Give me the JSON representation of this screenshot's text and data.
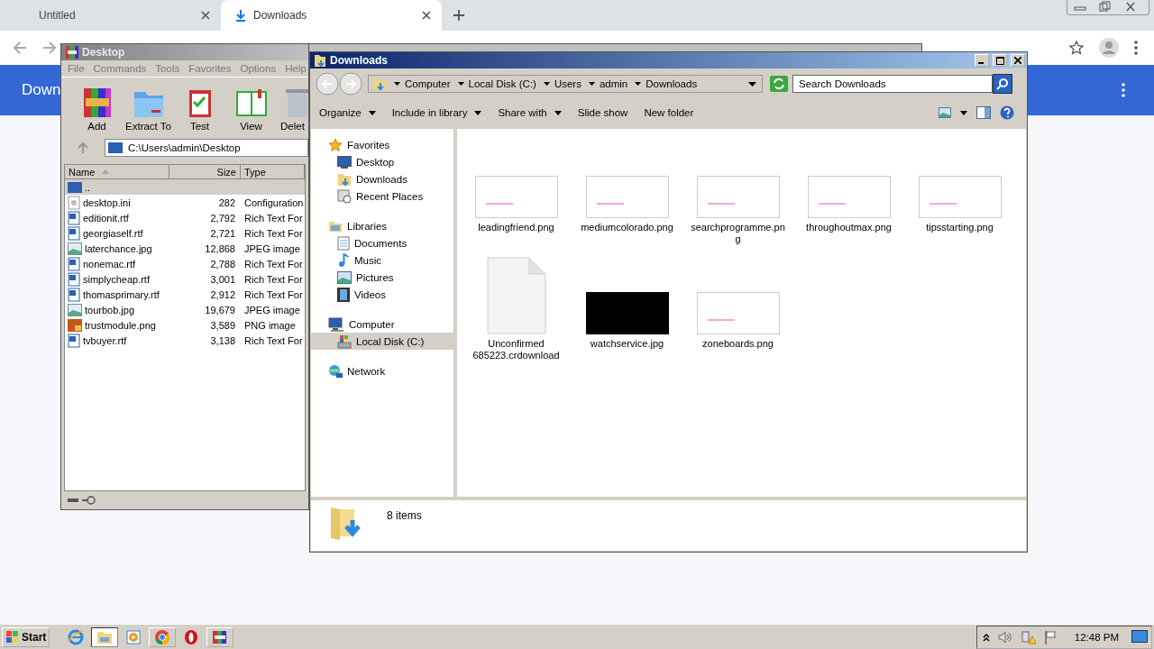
{
  "browser": {
    "tabs": [
      {
        "title": "Untitled",
        "selected": false
      },
      {
        "title": "Downloads",
        "selected": true
      }
    ],
    "header_title": "Down"
  },
  "winrar": {
    "title": "Desktop",
    "menu": [
      "File",
      "Commands",
      "Tools",
      "Favorites",
      "Options",
      "Help"
    ],
    "tools": [
      {
        "label": "Add",
        "kind": "add"
      },
      {
        "label": "Extract To",
        "kind": "extract"
      },
      {
        "label": "Test",
        "kind": "test"
      },
      {
        "label": "View",
        "kind": "view"
      },
      {
        "label": "Delet",
        "kind": "delete"
      }
    ],
    "path": "C:\\Users\\admin\\Desktop",
    "columns": [
      "Name",
      "Size",
      "Type"
    ],
    "rows": [
      {
        "name": "..",
        "kind": "up",
        "selected": true
      },
      {
        "name": "desktop.ini",
        "size": "282",
        "type": "Configuration",
        "kind": "ini",
        "selected": false
      },
      {
        "name": "editionit.rtf",
        "size": "2,792",
        "type": "Rich Text For",
        "kind": "rtf",
        "selected": false
      },
      {
        "name": "georgiaself.rtf",
        "size": "2,721",
        "type": "Rich Text For",
        "kind": "rtf",
        "selected": false
      },
      {
        "name": "laterchance.jpg",
        "size": "12,868",
        "type": "JPEG image",
        "kind": "jpg",
        "selected": false
      },
      {
        "name": "nonemac.rtf",
        "size": "2,788",
        "type": "Rich Text For",
        "kind": "rtf",
        "selected": false
      },
      {
        "name": "simplycheap.rtf",
        "size": "3,001",
        "type": "Rich Text For",
        "kind": "rtf",
        "selected": false
      },
      {
        "name": "thomasprimary.rtf",
        "size": "2,912",
        "type": "Rich Text For",
        "kind": "rtf",
        "selected": false
      },
      {
        "name": "tourbob.jpg",
        "size": "19,679",
        "type": "JPEG image",
        "kind": "jpg",
        "selected": false
      },
      {
        "name": "trustmodule.png",
        "size": "3,589",
        "type": "PNG image",
        "kind": "png",
        "selected": false
      },
      {
        "name": "tvbuyer.rtf",
        "size": "3,138",
        "type": "Rich Text For",
        "kind": "rtf",
        "selected": false
      }
    ]
  },
  "explorer": {
    "title": "Downloads",
    "breadcrumb": [
      "Computer",
      "Local Disk (C:)",
      "Users",
      "admin",
      "Downloads"
    ],
    "search": {
      "placeholder": "Search Downloads"
    },
    "commands": [
      {
        "label": "Organize",
        "menu": true
      },
      {
        "label": "Include in library",
        "menu": true
      },
      {
        "label": "Share with",
        "menu": true
      },
      {
        "label": "Slide show",
        "menu": false
      },
      {
        "label": "New folder",
        "menu": false
      }
    ],
    "nav": [
      {
        "label": "Favorites",
        "kind": "star",
        "selected": false,
        "children": [
          {
            "label": "Desktop",
            "kind": "desktop",
            "selected": false
          },
          {
            "label": "Downloads",
            "kind": "downloads",
            "selected": false
          },
          {
            "label": "Recent Places",
            "kind": "recent",
            "selected": false
          }
        ]
      },
      {
        "label": "Libraries",
        "kind": "libraries",
        "selected": false,
        "children": [
          {
            "label": "Documents",
            "kind": "documents",
            "selected": false
          },
          {
            "label": "Music",
            "kind": "music",
            "selected": false
          },
          {
            "label": "Pictures",
            "kind": "pictures",
            "selected": false
          },
          {
            "label": "Videos",
            "kind": "videos",
            "selected": false
          }
        ]
      },
      {
        "label": "Computer",
        "kind": "computer",
        "selected": false,
        "children": [
          {
            "label": "Local Disk (C:)",
            "kind": "disk",
            "selected": true
          }
        ]
      },
      {
        "label": "Network",
        "kind": "network",
        "selected": false
      }
    ],
    "files": [
      {
        "name": "leadingfriend.png",
        "kind": "thumb"
      },
      {
        "name": "mediumcolorado.png",
        "kind": "thumb"
      },
      {
        "name": "searchprogramme.png",
        "kind": "thumb"
      },
      {
        "name": "throughoutmax.png",
        "kind": "thumb"
      },
      {
        "name": "tipsstarting.png",
        "kind": "thumb"
      },
      {
        "name": "Unconfirmed 685223.crdownload",
        "kind": "file"
      },
      {
        "name": "watchservice.jpg",
        "kind": "dark"
      },
      {
        "name": "zoneboards.png",
        "kind": "thumb"
      }
    ],
    "item_count": "8 items"
  },
  "taskbar": {
    "start": "Start",
    "apps": [
      {
        "kind": "ie"
      },
      {
        "kind": "explorer"
      },
      {
        "kind": "media"
      },
      {
        "kind": "chrome"
      },
      {
        "kind": "opera"
      },
      {
        "kind": "winrar"
      }
    ],
    "clock": "12:48 PM"
  }
}
